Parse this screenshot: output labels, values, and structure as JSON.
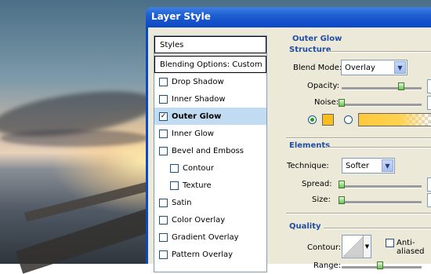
{
  "window": {
    "title": "Layer Style"
  },
  "styles_list": {
    "header": "Styles",
    "blending": "Blending Options: Custom",
    "items": [
      {
        "label": "Drop Shadow",
        "checked": false,
        "indent": false,
        "selected": false
      },
      {
        "label": "Inner Shadow",
        "checked": false,
        "indent": false,
        "selected": false
      },
      {
        "label": "Outer Glow",
        "checked": true,
        "indent": false,
        "selected": true
      },
      {
        "label": "Inner Glow",
        "checked": false,
        "indent": false,
        "selected": false
      },
      {
        "label": "Bevel and Emboss",
        "checked": false,
        "indent": false,
        "selected": false
      },
      {
        "label": "Contour",
        "checked": false,
        "indent": true,
        "selected": false
      },
      {
        "label": "Texture",
        "checked": false,
        "indent": true,
        "selected": false
      },
      {
        "label": "Satin",
        "checked": false,
        "indent": false,
        "selected": false
      },
      {
        "label": "Color Overlay",
        "checked": false,
        "indent": false,
        "selected": false
      },
      {
        "label": "Gradient Overlay",
        "checked": false,
        "indent": false,
        "selected": false
      },
      {
        "label": "Pattern Overlay",
        "checked": false,
        "indent": false,
        "selected": false
      }
    ],
    "check_glyph": "✓"
  },
  "outer_glow": {
    "title": "Outer Glow",
    "structure": {
      "title": "Structure",
      "blend_mode_label": "Blend Mode:",
      "blend_mode_value": "Overlay",
      "opacity_label": "Opacity:",
      "noise_label": "Noise:",
      "opacity_level": 0.78,
      "noise_level": 0.0,
      "color_swatch": "#f7be1e",
      "gradient_start": "#ffc93c"
    },
    "elements": {
      "title": "Elements",
      "technique_label": "Technique:",
      "technique_value": "Softer",
      "spread_label": "Spread:",
      "size_label": "Size:",
      "spread_level": 0.0,
      "size_level": 0.0
    },
    "quality": {
      "title": "Quality",
      "contour_label": "Contour:",
      "anti_aliased_label": "Anti-aliased",
      "range_label": "Range:",
      "range_level": 0.5
    }
  },
  "colors": {
    "titlebar": "#1d5bd1",
    "accent_text": "#1f4ea3",
    "selection": "#c1dcf2",
    "dialog_bg": "#ece9d8"
  }
}
